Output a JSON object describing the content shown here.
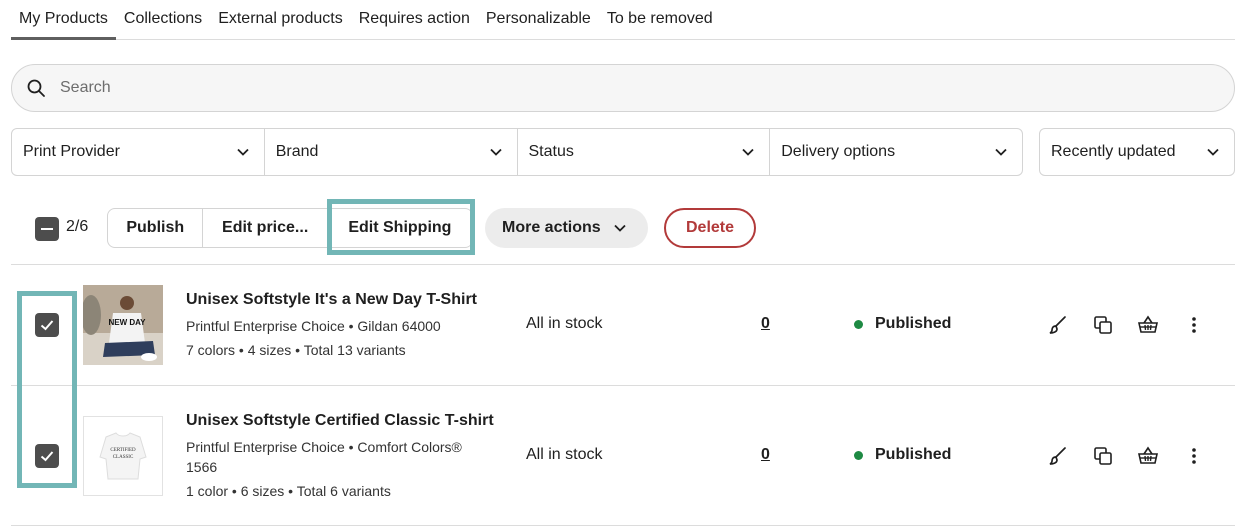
{
  "tabs": [
    {
      "label": "My Products",
      "active": true
    },
    {
      "label": "Collections",
      "active": false
    },
    {
      "label": "External products",
      "active": false
    },
    {
      "label": "Requires action",
      "active": false
    },
    {
      "label": "Personalizable",
      "active": false
    },
    {
      "label": "To be removed",
      "active": false
    }
  ],
  "search": {
    "placeholder": "Search",
    "icon": "search-icon"
  },
  "filters": {
    "print_provider": "Print Provider",
    "brand": "Brand",
    "status": "Status",
    "delivery": "Delivery options",
    "sort": "Recently updated"
  },
  "actions": {
    "selected_count": "2/6",
    "publish": "Publish",
    "edit_price": "Edit price...",
    "edit_shipping": "Edit Shipping",
    "more_actions": "More actions",
    "delete": "Delete"
  },
  "products": [
    {
      "title": "Unisex Softstyle It's a New Day T-Shirt",
      "provider": "Printful Enterprise Choice • Gildan 64000",
      "variants": "7 colors • 4 sizes • Total 13 variants",
      "stock": "All in stock",
      "orders": "0",
      "status": "Published",
      "checked": true,
      "thumb_text": "NEW DAY"
    },
    {
      "title": "Unisex Softstyle Certified Classic T-shirt",
      "provider": "Printful Enterprise Choice • Comfort Colors®",
      "provider_cont": "1566",
      "variants": "1 color • 6 sizes • Total 6 variants",
      "stock": "All in stock",
      "orders": "0",
      "status": "Published",
      "checked": true,
      "thumb_text_1": "CERTIFIED",
      "thumb_text_2": "CLASSIC"
    }
  ],
  "colors": {
    "accent_highlight": "#72b6b6",
    "delete": "#b23a3a",
    "published_dot": "#1e8a43"
  }
}
